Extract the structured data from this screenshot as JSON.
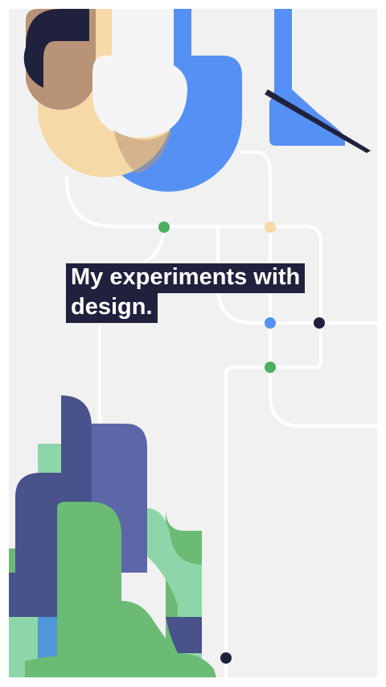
{
  "hero": {
    "headline_lines": [
      "My experiments with",
      "design."
    ]
  },
  "illustration": {
    "top": "person drawing with a pen",
    "bottom": "abstract forest of rounded trees",
    "middle": "network of lines connecting dots"
  },
  "colors": {
    "background": "#f1f1f1",
    "line": "#ffffff",
    "navy": "#20213d",
    "blue": "#5591f4",
    "green": "#4cae5e",
    "peach": "#f5d9a7",
    "skin": "#b89378",
    "shirt": "#f5f5f7",
    "headline_bg": "#20213d",
    "headline_text": "#ffffff",
    "tree_indigo": "#49528a",
    "tree_violet": "#5c67a8",
    "tree_green": "#6bbb74",
    "tree_mint": "#8ed6a9",
    "tree_blue": "#4f97d8"
  }
}
